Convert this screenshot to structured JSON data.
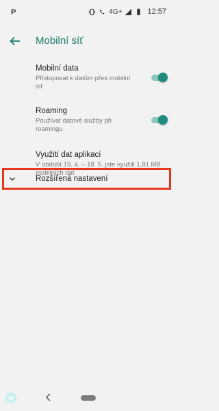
{
  "status_bar": {
    "app_icon_letter": "P",
    "network_label": "4G+",
    "time": "12:57"
  },
  "toolbar": {
    "title": "Mobilní síť"
  },
  "settings": [
    {
      "title": "Mobilní data",
      "subtitle": "Přistupovat k datům přes mobilní síť",
      "toggle_on": true
    },
    {
      "title": "Roaming",
      "subtitle": "Používat datové služby při roamingu",
      "toggle_on": true
    },
    {
      "title": "Využití dat aplikací",
      "subtitle": "V období 19. 4. – 18. 5. jste využili 1,81 MB mobilních dat"
    }
  ],
  "advanced": {
    "label": "Rozšířená nastavení"
  },
  "colors": {
    "accent": "#1a7a6e",
    "highlight_border": "#e6361f",
    "background": "#f2f2f2"
  }
}
